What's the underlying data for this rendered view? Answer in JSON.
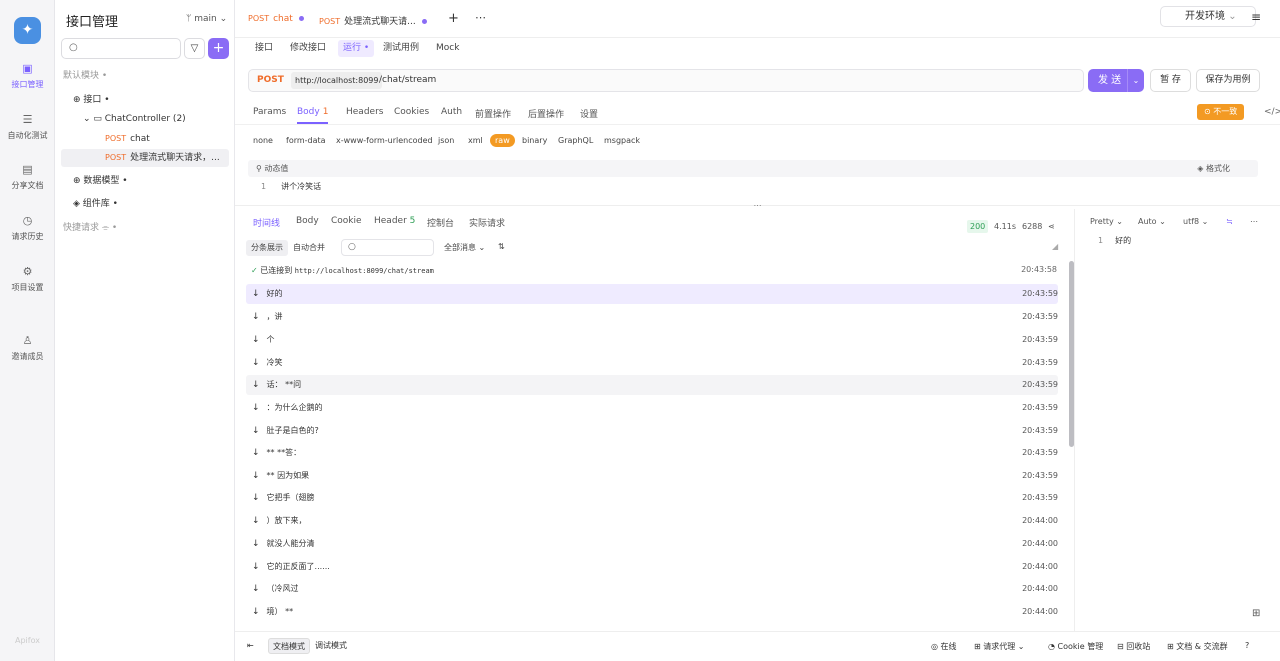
{
  "rail": {
    "logo": "✦",
    "items": [
      {
        "label": "接口管理",
        "icon": "api-icon",
        "glyph": "▣"
      },
      {
        "label": "自动化测试",
        "icon": "automation-icon",
        "glyph": "☰"
      },
      {
        "label": "分享文档",
        "icon": "book-icon",
        "glyph": "▤"
      },
      {
        "label": "请求历史",
        "icon": "history-icon",
        "glyph": "◷"
      },
      {
        "label": "项目设置",
        "icon": "settings-icon",
        "glyph": "⚙"
      },
      {
        "label": "邀请成员",
        "icon": "invite-icon",
        "glyph": "♙"
      }
    ],
    "footer": "Apifox"
  },
  "sidebar": {
    "title": "接口管理",
    "branch": "ᛘ main ⌄",
    "tree": [
      {
        "text": "默认模块 •",
        "muted": true
      },
      {
        "text": "⊕ 接口 •"
      },
      {
        "text": "⌄ ▭ ChatController (2)"
      },
      {
        "method": "POST",
        "text": "chat"
      },
      {
        "method": "POST",
        "text": "处理流式聊天请求，..."
      },
      {
        "text": "⊕ 数据模型 •"
      },
      {
        "text": "◈ 组件库 •"
      },
      {
        "text": "快捷请求 ⌯ •",
        "muted": true
      }
    ]
  },
  "tabs": [
    {
      "method": "POST",
      "name": "chat"
    },
    {
      "method": "POST",
      "name": "处理流式聊天请..."
    }
  ],
  "env": "开发环境",
  "subtabs": [
    "接口",
    "修改接口",
    "运行 •",
    "测试用例",
    "Mock"
  ],
  "request": {
    "method": "POST",
    "base_url": "http://localhost:8099",
    "path": "/chat/stream",
    "send": "发 送",
    "save": "暂 存",
    "save_as": "保存为用例"
  },
  "request_tabs": [
    "Params",
    "Body",
    "Headers",
    "Cookies",
    "Auth",
    "前置操作",
    "后置操作",
    "设置"
  ],
  "body_count": "1",
  "mismatch": "不一致",
  "body_types": [
    "none",
    "form-data",
    "x-www-form-urlencoded",
    "json",
    "xml",
    "raw",
    "binary",
    "GraphQL",
    "msgpack"
  ],
  "dynamic_label": "动态值",
  "format_label": "格式化",
  "body_line": "讲个冷笑话",
  "response": {
    "tabs": [
      "时间线",
      "Body",
      "Cookie",
      "Header",
      "控制台",
      "实际请求"
    ],
    "header_count": "5",
    "status": "200",
    "time": "4.11s",
    "size": "6288",
    "view_modes": [
      "分条展示",
      "自动合并"
    ],
    "filter": "全部消息",
    "connected_text": "已连接到",
    "connected_url": "http://localhost:8099/chat/stream",
    "connected_time": "20:43:58",
    "messages": [
      {
        "text": "好的",
        "time": "20:43:59"
      },
      {
        "text": "，讲",
        "time": "20:43:59"
      },
      {
        "text": "个",
        "time": "20:43:59"
      },
      {
        "text": "冷笑",
        "time": "20:43:59"
      },
      {
        "text": "话：  **问",
        "time": "20:43:59"
      },
      {
        "text": "：为什么企鹅的",
        "time": "20:43:59"
      },
      {
        "text": "肚子是白色的?",
        "time": "20:43:59"
      },
      {
        "text": "**  **答：",
        "time": "20:43:59"
      },
      {
        "text": "**  因为如果",
        "time": "20:43:59"
      },
      {
        "text": "它把手（翅膀",
        "time": "20:43:59"
      },
      {
        "text": "）放下来，",
        "time": "20:44:00"
      },
      {
        "text": "就没人能分清",
        "time": "20:44:00"
      },
      {
        "text": "它的正反面了......",
        "time": "20:44:00"
      },
      {
        "text": "（冷风过",
        "time": "20:44:00"
      },
      {
        "text": "境）  **",
        "time": "20:44:00"
      }
    ],
    "pretty": "Pretty",
    "auto": "Auto",
    "encoding": "utf8",
    "preview_line": "好的"
  },
  "footer": {
    "modes": [
      "文档模式",
      "调试模式"
    ],
    "items": [
      "◎ 在线",
      "⊞ 请求代理 ⌄",
      "◔ Cookie 管理",
      "⊟ 回收站",
      "⊞ 文档 & 交流群"
    ]
  }
}
